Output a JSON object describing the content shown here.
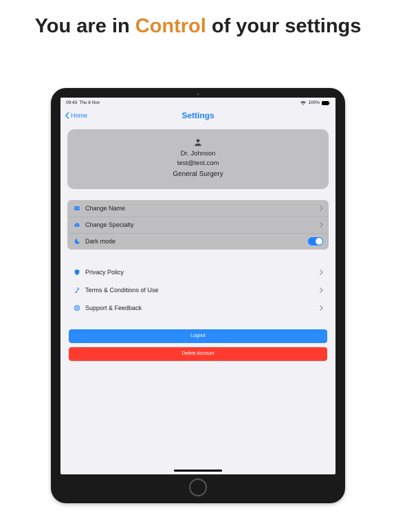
{
  "promo": {
    "pre": "You are in ",
    "accent": "Control",
    "post": " of your settings"
  },
  "status": {
    "time": "09:43",
    "date": "Thu 8 Nov",
    "battery": "100%"
  },
  "nav": {
    "back": "Home",
    "title": "Settings"
  },
  "profile": {
    "name": "Dr. Johnson",
    "email": "test@test.com",
    "specialty": "General Surgery"
  },
  "group1": {
    "change_name": "Change Name",
    "change_specialty": "Change Specialty",
    "dark_mode": "Dark mode"
  },
  "group2": {
    "privacy": "Privacy Policy",
    "terms": "Terms & Conditions of Use",
    "support": "Support & Feedback"
  },
  "actions": {
    "logout": "Logout",
    "delete": "Delete Account"
  }
}
